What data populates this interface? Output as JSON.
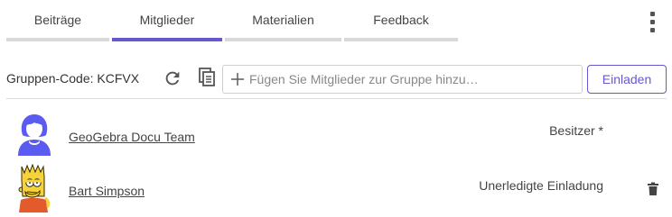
{
  "tabs": [
    {
      "label": "Beiträge",
      "active": false
    },
    {
      "label": "Mitglieder",
      "active": true
    },
    {
      "label": "Materialien",
      "active": false
    },
    {
      "label": "Feedback",
      "active": false
    }
  ],
  "toolbar": {
    "group_code_label": "Gruppen-Code: KCFVX",
    "add_member_placeholder": "Fügen Sie Mitglieder zur Gruppe hinzu…",
    "invite_label": "Einladen"
  },
  "members": [
    {
      "name": "GeoGebra Docu Team",
      "role": "Besitzer *",
      "avatar": "default-user-avatar"
    },
    {
      "name": "Bart Simpson",
      "role": "Unerledigte Einladung",
      "avatar": "bart-simpson-avatar"
    }
  ],
  "colors": {
    "accent": "#6557d2",
    "avatar_blue": "#5a5bf0",
    "tab_inactive": "#d9d9d9"
  },
  "icons": {
    "menu": "more-vertical-icon",
    "refresh": "refresh-icon",
    "copy": "copy-icon",
    "plus": "plus-icon",
    "trash": "trash-icon"
  }
}
